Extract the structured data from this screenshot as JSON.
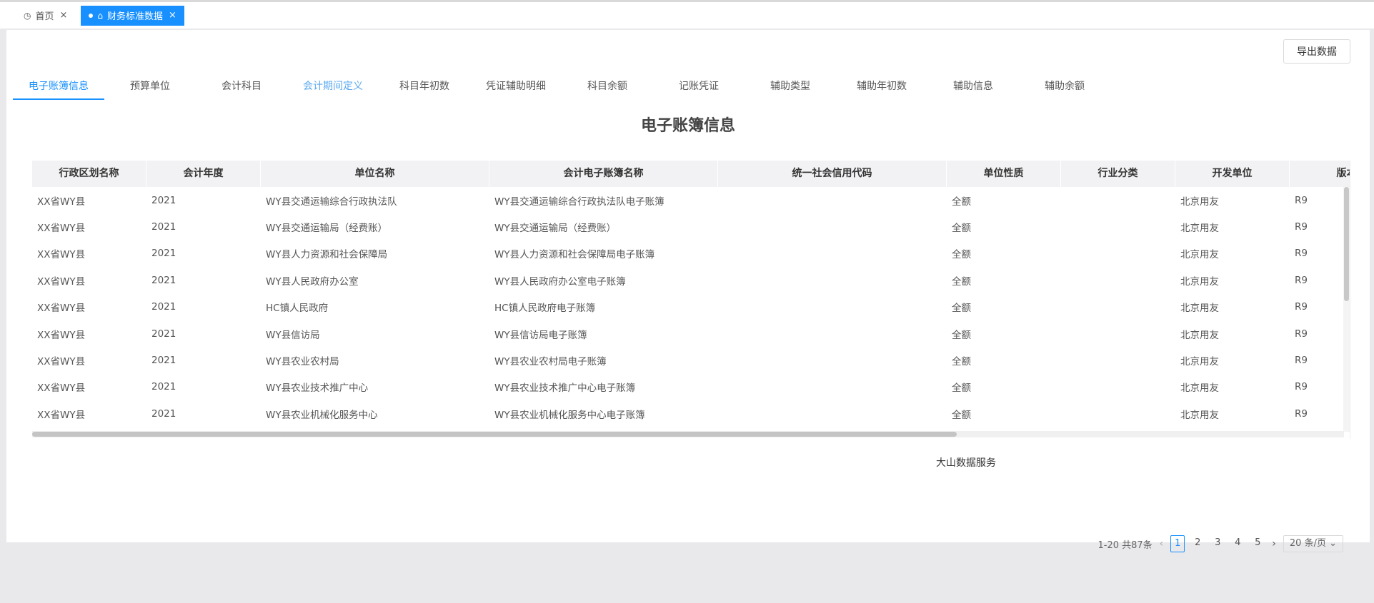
{
  "tabs": [
    {
      "label": "首页",
      "active": false
    },
    {
      "label": "财务标准数据",
      "active": true
    }
  ],
  "export_label": "导出数据",
  "subtabs": [
    {
      "label": "电子账簿信息",
      "state": "active"
    },
    {
      "label": "预算单位",
      "state": ""
    },
    {
      "label": "会计科目",
      "state": ""
    },
    {
      "label": "会计期间定义",
      "state": "hover"
    },
    {
      "label": "科目年初数",
      "state": ""
    },
    {
      "label": "凭证辅助明细",
      "state": ""
    },
    {
      "label": "科目余额",
      "state": ""
    },
    {
      "label": "记账凭证",
      "state": ""
    },
    {
      "label": "辅助类型",
      "state": ""
    },
    {
      "label": "辅助年初数",
      "state": ""
    },
    {
      "label": "辅助信息",
      "state": ""
    },
    {
      "label": "辅助余额",
      "state": ""
    }
  ],
  "page_title": "电子账簿信息",
  "table": {
    "columns": [
      "行政区划名称",
      "会计年度",
      "单位名称",
      "会计电子账簿名称",
      "统一社会信用代码",
      "单位性质",
      "行业分类",
      "开发单位",
      "版本"
    ],
    "rows": [
      [
        "XX省WY县",
        "2021",
        "WY县交通运输综合行政执法队",
        "WY县交通运输综合行政执法队电子账簿",
        "",
        "全额",
        "",
        "北京用友",
        "R9"
      ],
      [
        "XX省WY县",
        "2021",
        "WY县交通运输局（经费账）",
        "WY县交通运输局（经费账）",
        "",
        "全额",
        "",
        "北京用友",
        "R9"
      ],
      [
        "XX省WY县",
        "2021",
        "WY县人力资源和社会保障局",
        "WY县人力资源和社会保障局电子账簿",
        "",
        "全额",
        "",
        "北京用友",
        "R9"
      ],
      [
        "XX省WY县",
        "2021",
        "WY县人民政府办公室",
        "WY县人民政府办公室电子账簿",
        "",
        "全额",
        "",
        "北京用友",
        "R9"
      ],
      [
        "XX省WY县",
        "2021",
        "HC镇人民政府",
        "HC镇人民政府电子账簿",
        "",
        "全额",
        "",
        "北京用友",
        "R9"
      ],
      [
        "XX省WY县",
        "2021",
        "WY县信访局",
        "WY县信访局电子账簿",
        "",
        "全额",
        "",
        "北京用友",
        "R9"
      ],
      [
        "XX省WY县",
        "2021",
        "WY县农业农村局",
        "WY县农业农村局电子账簿",
        "",
        "全额",
        "",
        "北京用友",
        "R9"
      ],
      [
        "XX省WY县",
        "2021",
        "WY县农业技术推广中心",
        "WY县农业技术推广中心电子账簿",
        "",
        "全额",
        "",
        "北京用友",
        "R9"
      ],
      [
        "XX省WY县",
        "2021",
        "WY县农业机械化服务中心",
        "WY县农业机械化服务中心电子账簿",
        "",
        "全额",
        "",
        "北京用友",
        "R9"
      ]
    ]
  },
  "overlay_text": "大山数据服务",
  "pagination": {
    "summary": "1-20 共87条",
    "pages": [
      "1",
      "2",
      "3",
      "4",
      "5"
    ],
    "current": "1",
    "prev": "‹",
    "next": "›",
    "page_size": "20 条/页"
  }
}
